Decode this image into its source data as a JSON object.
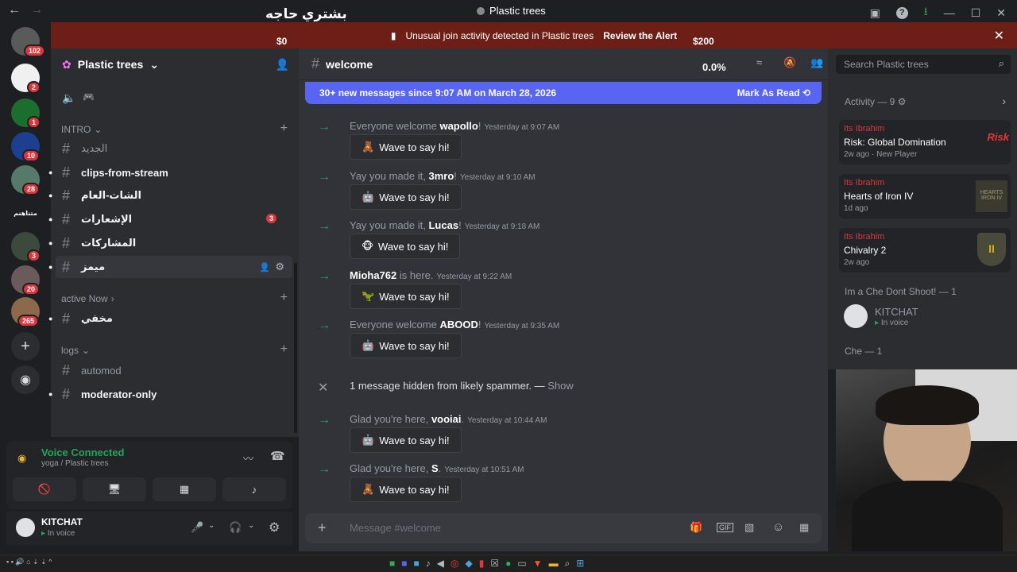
{
  "titlebar": {
    "stream_text": "بشتري حاجه",
    "window_title": "Plastic trees"
  },
  "alert": {
    "text": "Unusual join activity detected in Plastic trees",
    "review": "Review the Alert",
    "money_left": "$0",
    "money_right": "$200"
  },
  "rail": {
    "servers": [
      {
        "badge": "102"
      },
      {
        "badge": "2"
      },
      {
        "badge": "1"
      },
      {
        "badge": "10"
      },
      {
        "badge": "28"
      },
      {
        "label": "متناهنم"
      },
      {
        "badge": "3"
      },
      {
        "badge": "20"
      },
      {
        "badge": "265"
      }
    ]
  },
  "sidebar": {
    "server_name": "Plastic trees",
    "categories": {
      "intro": "INTRO",
      "active": "active Now",
      "logs": "logs"
    },
    "channels": [
      {
        "name": "الجديد"
      },
      {
        "name": "clips-from-stream"
      },
      {
        "name": "الشات-العام"
      },
      {
        "name": "الإشعارات",
        "badge": "3"
      },
      {
        "name": "المشاركات"
      },
      {
        "name": "ميمز"
      },
      {
        "name": "مخفي"
      },
      {
        "name": "automod"
      },
      {
        "name": "moderator-only"
      }
    ]
  },
  "voice": {
    "status": "Voice Connected",
    "location": "yoga / Plastic trees"
  },
  "user": {
    "name": "KITCHAT",
    "status": "In voice"
  },
  "chat": {
    "channel": "welcome",
    "stat": "0.0%",
    "search_placeholder": "Search Plastic trees",
    "new_messages": "30+ new messages since 9:07 AM on March 28, 2026",
    "mark_read": "Mark As Read",
    "composer_placeholder": "Message #welcome",
    "messages": [
      {
        "pre": "Everyone welcome ",
        "user": "wapollo",
        "post": "!",
        "time": "Yesterday at 9:07 AM",
        "wave": "Wave to say hi!"
      },
      {
        "pre": "Yay you made it, ",
        "user": "3mro",
        "post": "!",
        "time": "Yesterday at 9:10 AM",
        "wave": "Wave to say hi!"
      },
      {
        "pre": "Yay you made it, ",
        "user": "Lucas",
        "post": "!",
        "time": "Yesterday at 9:18 AM",
        "wave": "Wave to say hi!"
      },
      {
        "pre": "",
        "user": "Mioha762",
        "post": " is here.",
        "time": "Yesterday at 9:22 AM",
        "wave": "Wave to say hi!"
      },
      {
        "pre": "Everyone welcome ",
        "user": "ABOOD",
        "post": "!",
        "time": "Yesterday at 9:35 AM",
        "wave": "Wave to say hi!"
      },
      {
        "pre": "Glad you're here, ",
        "user": "vooiai",
        "post": ".",
        "time": "Yesterday at 10:44 AM",
        "wave": "Wave to say hi!"
      },
      {
        "pre": "Glad you're here, ",
        "user": "S",
        "post": ".",
        "time": "Yesterday at 10:51 AM",
        "wave": "Wave to say hi!"
      }
    ],
    "hidden": {
      "text": "1 message hidden from likely spammer. — ",
      "show": "Show"
    }
  },
  "members": {
    "activity_header": "Activity — 9",
    "activities": [
      {
        "user": "Its Ibrahim",
        "game": "Risk: Global Domination",
        "meta": "2w ago",
        "extra": "New Player",
        "thumb": "Risk"
      },
      {
        "user": "Its Ibrahim",
        "game": "Hearts of Iron IV",
        "meta": "1d ago",
        "thumb": "HEARTS IRON IV"
      },
      {
        "user": "Its Ibrahim",
        "game": "Chivalry 2",
        "meta": "2w ago",
        "thumb": "II"
      }
    ],
    "role1": "Im a Che Dont Shoot! — 1",
    "member1": {
      "name": "KITCHAT",
      "status": "In voice"
    },
    "role2": "Che — 1"
  },
  "colors": {
    "accent": "#5865f2",
    "alert_bg": "#6d1f17",
    "online": "#23a55a",
    "badge": "#da373c"
  }
}
